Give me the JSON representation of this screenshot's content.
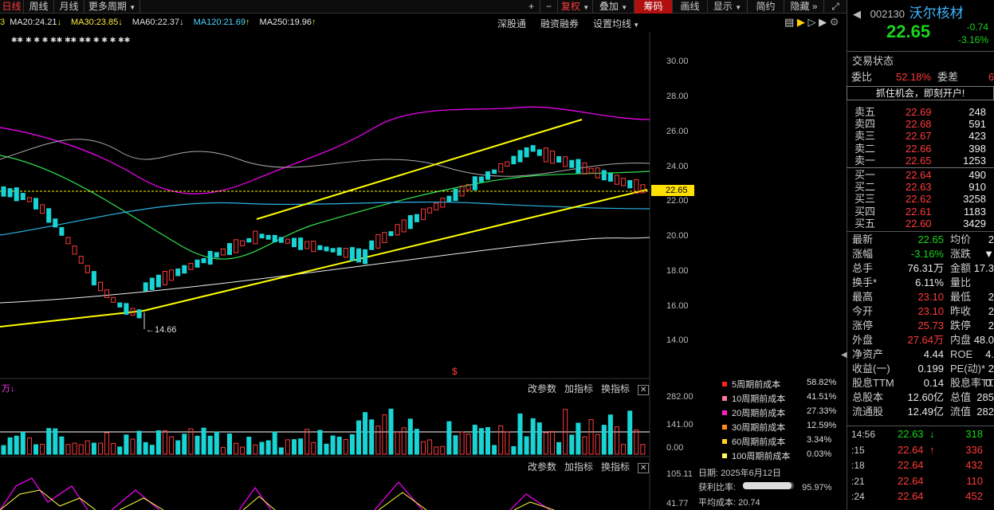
{
  "toolbar": {
    "left_tabs": [
      "日线",
      "周线",
      "月线",
      "更多周期"
    ],
    "plus": "+",
    "minus": "−",
    "fuquan": "复权",
    "diejia": "叠加",
    "chouma": "筹码",
    "huaxian": "画线",
    "xianshi": "显示",
    "jianyue": "简约",
    "yincang": "隐藏"
  },
  "ma_line": {
    "prefix": "3",
    "ma20": "MA20:24.21",
    "ma30": "MA30:23.85",
    "ma60": "MA60:22.37",
    "ma120": "MA120:21.69",
    "ma250": "MA250:19.96",
    "ma20_arrow": "↓",
    "ma30_arrow": "↓",
    "ma60_arrow": "↓",
    "ma120_arrow": "↑",
    "ma250_arrow": "↑"
  },
  "chart_links": [
    "深股通",
    "融资融券",
    "设置均线"
  ],
  "stock": {
    "code": "002130",
    "name": "沃尔核材",
    "price": "22.65",
    "change": "-0.74",
    "change_pct": "-3.16%"
  },
  "quote_panel": {
    "status_label": "交易状态",
    "weibi_label": "委比",
    "weibi_value": "52.18%",
    "weicha_label": "委差",
    "weicha_value": "6",
    "banner": "抓住机会，即刻开户!",
    "asks": [
      {
        "label": "卖五",
        "price": "22.69",
        "vol": "248"
      },
      {
        "label": "卖四",
        "price": "22.68",
        "vol": "591"
      },
      {
        "label": "卖三",
        "price": "22.67",
        "vol": "423"
      },
      {
        "label": "卖二",
        "price": "22.66",
        "vol": "398"
      },
      {
        "label": "卖一",
        "price": "22.65",
        "vol": "1253"
      }
    ],
    "bids": [
      {
        "label": "买一",
        "price": "22.64",
        "vol": "490"
      },
      {
        "label": "买二",
        "price": "22.63",
        "vol": "910"
      },
      {
        "label": "买三",
        "price": "22.62",
        "vol": "3258"
      },
      {
        "label": "买四",
        "price": "22.61",
        "vol": "1183"
      },
      {
        "label": "买五",
        "price": "22.60",
        "vol": "3429"
      }
    ],
    "stats": [
      {
        "l1": "最新",
        "v1": "22.65",
        "l2": "均价",
        "v2": "2"
      },
      {
        "l1": "涨幅",
        "v1": "-3.16%",
        "l2": "涨跌",
        "v2": "▼"
      },
      {
        "l1": "总手",
        "v1": "76.31万",
        "l2": "金额",
        "v2": "17.3"
      },
      {
        "l1": "换手*",
        "v1": "6.11%",
        "l2": "量比",
        "v2": ""
      },
      {
        "l1": "最高",
        "v1": "23.10",
        "l2": "最低",
        "v2": "2"
      },
      {
        "l1": "今开",
        "v1": "23.10",
        "l2": "昨收",
        "v2": "2"
      },
      {
        "l1": "涨停",
        "v1": "25.73",
        "l2": "跌停",
        "v2": "2"
      },
      {
        "l1": "外盘",
        "v1": "27.64万",
        "l2": "内盘",
        "v2": "48.0"
      },
      {
        "l1": "净资产",
        "v1": "4.44",
        "l2": "ROE",
        "v2": "4."
      },
      {
        "l1": "收益(一)",
        "v1": "0.199",
        "l2": "PE(动)*",
        "v2": "2"
      },
      {
        "l1": "股息TTM",
        "v1": "0.14",
        "l2": "股息率TTM",
        "v2": "0."
      },
      {
        "l1": "总股本",
        "v1": "12.60亿",
        "l2": "总值",
        "v2": "285"
      },
      {
        "l1": "流通股",
        "v1": "12.49亿",
        "l2": "流值",
        "v2": "282"
      }
    ],
    "ticks": [
      {
        "time": "14:56",
        "price": "22.63",
        "arrow": "↓",
        "vol": "318"
      },
      {
        "time": ":15",
        "price": "22.64",
        "arrow": "↑",
        "vol": "336"
      },
      {
        "time": ":18",
        "price": "22.64",
        "arrow": "",
        "vol": "432"
      },
      {
        "time": ":21",
        "price": "22.64",
        "arrow": "",
        "vol": "110"
      },
      {
        "time": ":24",
        "price": "22.64",
        "arrow": "",
        "vol": "452"
      }
    ]
  },
  "price_axis": [
    "30.00",
    "28.00",
    "26.00",
    "24.00",
    "22.00",
    "20.00",
    "18.00",
    "16.00",
    "14.00"
  ],
  "current_price_tag": "22.65",
  "low_annotation": "←14.66",
  "indicator_bar": [
    "改参数",
    "加指标",
    "换指标"
  ],
  "volume_axis": [
    "282.00",
    "141.00",
    "0.00"
  ],
  "lower_axis": [
    "105.11",
    "41.77"
  ],
  "chip_legend": [
    {
      "label": "5周期前成本",
      "pct": "58.82%",
      "color": "#ff2020"
    },
    {
      "label": "10周期前成本",
      "pct": "41.51%",
      "color": "#ff7a9a"
    },
    {
      "label": "20周期前成本",
      "pct": "27.33%",
      "color": "#ff20c0"
    },
    {
      "label": "30周期前成本",
      "pct": "12.59%",
      "color": "#ff8a20"
    },
    {
      "label": "60周期前成本",
      "pct": "3.34%",
      "color": "#ffd020"
    },
    {
      "label": "100周期前成本",
      "pct": "0.03%",
      "color": "#ffff60"
    }
  ],
  "chip_info": {
    "date_label": "日期:",
    "date": "2025年6月12日",
    "ratio_label": "获利比率:",
    "ratio": "95.97%",
    "ratio_fill": 0.9597,
    "avg_label": "平均成本:",
    "avg": "20.74"
  },
  "colors": {
    "up": "#ff3b3b",
    "down": "#19d4d4",
    "trend": "#ffff00"
  }
}
